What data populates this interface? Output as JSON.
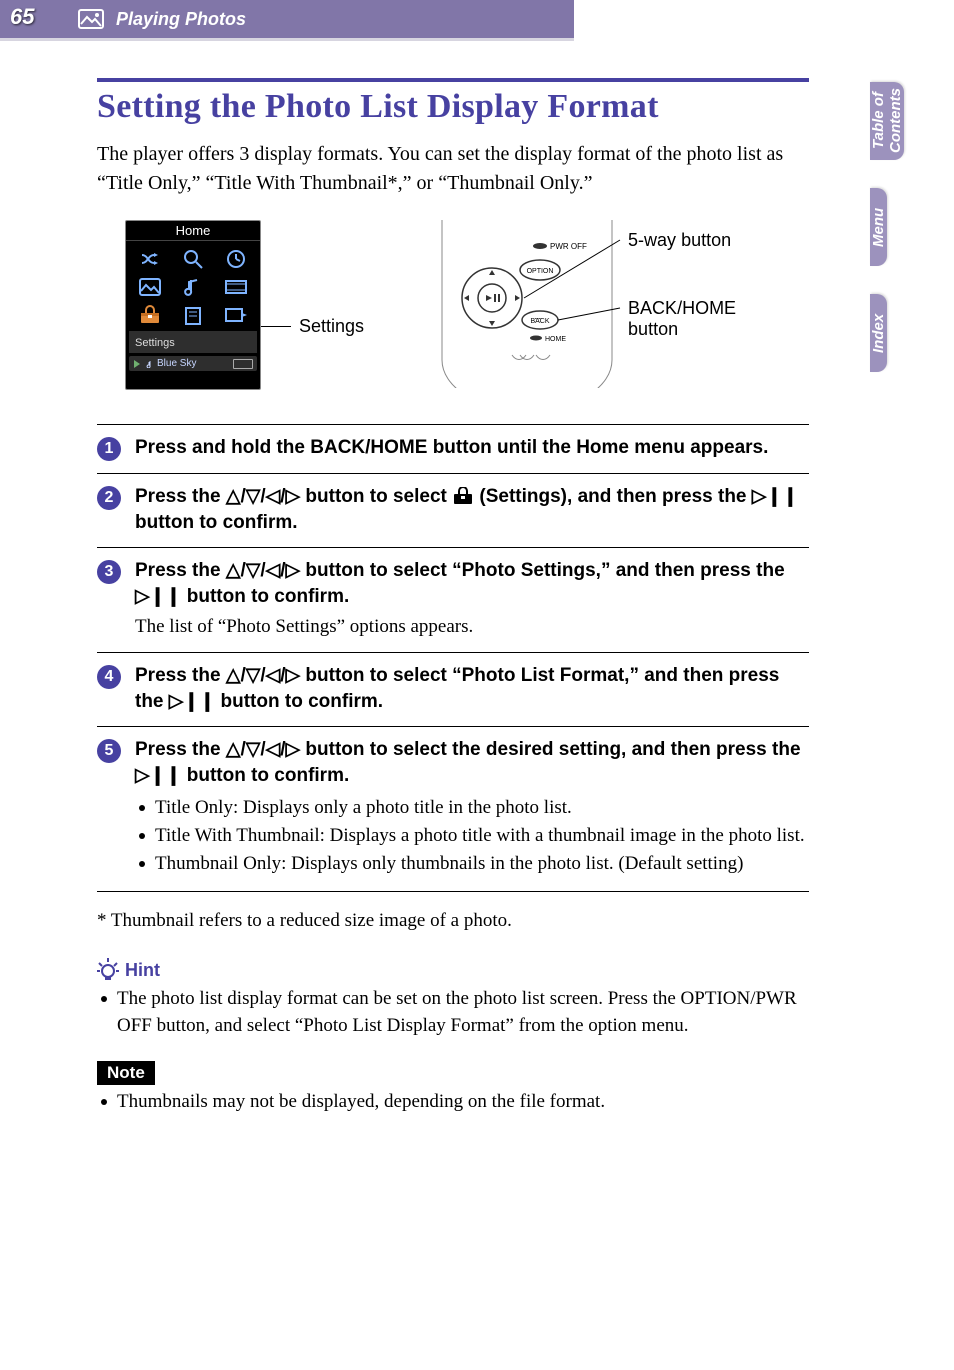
{
  "header": {
    "page_number": "65",
    "section": "Playing Photos"
  },
  "tabs": {
    "toc": "Table of\nContents",
    "menu": "Menu",
    "index": "Index"
  },
  "title": "Setting the Photo List Display Format",
  "intro": "The player offers 3 display formats. You can set the display format of the photo list as “Title Only,” “Title With Thumbnail*,” or “Thumbnail Only.”",
  "figure": {
    "screen_title": "Home",
    "selected_label": "Settings",
    "now_playing": "Blue Sky",
    "callout_settings": "Settings",
    "callout_5way": "5-way button",
    "callout_backhome": "BACK/HOME\nbutton",
    "pwr_off": "PWR OFF",
    "option": "OPTION",
    "back": "BACK",
    "home": "HOME"
  },
  "steps": [
    {
      "num": "1",
      "head": "Press and hold the BACK/HOME button until the Home menu appears."
    },
    {
      "num": "2",
      "head_pre": "Press the ",
      "head_mid": " button to select ",
      "head_post": " (Settings), and then press the ",
      "head_end": " button to confirm."
    },
    {
      "num": "3",
      "head_pre": "Press the ",
      "head_mid": " button to select “Photo Settings,” and then press the ",
      "head_end": " button to confirm.",
      "note": "The list of “Photo Settings” options appears."
    },
    {
      "num": "4",
      "head_pre": "Press the ",
      "head_mid": " button to select “Photo List Format,” and then press the ",
      "head_end": " button to confirm."
    },
    {
      "num": "5",
      "head_pre": "Press the ",
      "head_mid": " button to select the desired setting, and then press the ",
      "head_end": " button to confirm.",
      "bullets": [
        "Title Only: Displays only a photo title in the photo list.",
        "Title With Thumbnail: Displays a photo title with a thumbnail image in the photo list.",
        "Thumbnail Only: Displays only thumbnails in the photo list. (Default setting)"
      ]
    }
  ],
  "footnote": "*  Thumbnail refers to a reduced size image of a photo.",
  "hint": {
    "label": "Hint",
    "items": [
      "The photo list display format can be set on the photo list screen. Press the OPTION/PWR OFF button, and select “Photo List Display Format” from the option menu."
    ]
  },
  "note": {
    "label": "Note",
    "items": [
      "Thumbnails may not be displayed, depending on the file format."
    ]
  },
  "glyphs": {
    "dpad": "△/▽/◁/▷",
    "play": "▷❙❙"
  }
}
